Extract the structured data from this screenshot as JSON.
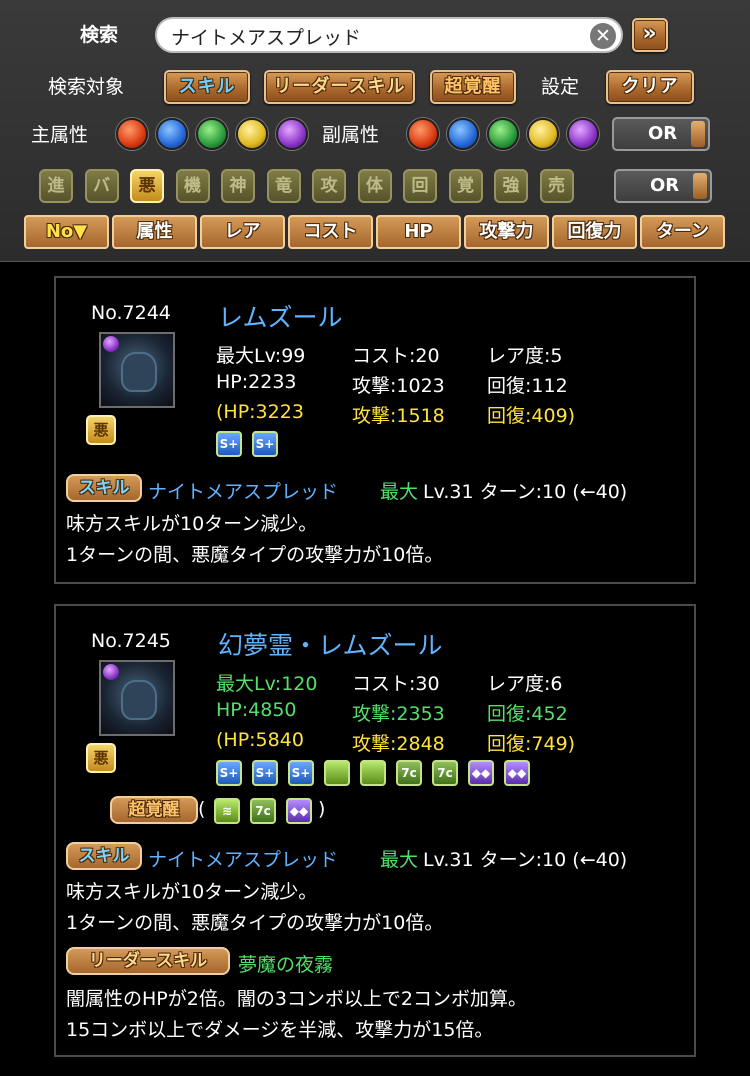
{
  "search": {
    "title": "検索",
    "query": "ナイトメアスプレッド",
    "clear_glyph": "✕",
    "go_glyph": "»"
  },
  "target_row": {
    "label": "検索対象",
    "skill": "スキル",
    "leader": "リーダースキル",
    "super": "超覚醒",
    "settings_label": "設定",
    "clear": "クリア"
  },
  "attr_row": {
    "main_label": "主属性",
    "sub_label": "副属性",
    "toggle": "OR"
  },
  "type_row": {
    "toggle": "OR",
    "types": [
      {
        "name": "evo-icon",
        "glyph": "進"
      },
      {
        "name": "balance-icon",
        "glyph": "バ"
      },
      {
        "name": "devil-icon",
        "glyph": "悪"
      },
      {
        "name": "machine-icon",
        "glyph": "機"
      },
      {
        "name": "god-icon",
        "glyph": "神"
      },
      {
        "name": "dragon-icon",
        "glyph": "竜"
      },
      {
        "name": "attacker-icon",
        "glyph": "攻"
      },
      {
        "name": "physical-icon",
        "glyph": "体"
      },
      {
        "name": "healer-icon",
        "glyph": "回"
      },
      {
        "name": "awaken-material-icon",
        "glyph": "覚"
      },
      {
        "name": "enhance-material-icon",
        "glyph": "強"
      },
      {
        "name": "sell-icon",
        "glyph": "売"
      }
    ]
  },
  "sort": [
    "No▼",
    "属性",
    "レア",
    "コスト",
    "HP",
    "攻撃力",
    "回復力",
    "ターン"
  ],
  "cards": [
    {
      "no": "No.7244",
      "name": "レムズール",
      "maxlv": "最大Lv:99",
      "cost": "コスト:20",
      "rarity": "レア度:5",
      "hp": "HP:2233",
      "atk": "攻撃:1023",
      "rcv": "回復:112",
      "hp_plus": "(HP:3223",
      "atk_plus": "攻撃:1518",
      "rcv_plus": "回復:409)",
      "skill_tag": "スキル",
      "skill_name": "ナイトメアスプレッド",
      "skill_max": "最大",
      "skill_lv": "Lv.31 ターン:10 (←40)",
      "skill_desc1": "味方スキルが10ターン減少。",
      "skill_desc2": "1ターンの間、悪魔タイプの攻撃力が10倍。"
    },
    {
      "no": "No.7245",
      "name": "幻夢霊・レムズール",
      "maxlv": "最大Lv:120",
      "cost": "コスト:30",
      "rarity": "レア度:6",
      "hp": "HP:4850",
      "atk": "攻撃:2353",
      "rcv": "回復:452",
      "hp_plus": "(HP:5840",
      "atk_plus": "攻撃:2848",
      "rcv_plus": "回復:749)",
      "super_label": "超覚醒",
      "super_open": "(",
      "super_close": ")",
      "skill_tag": "スキル",
      "skill_name": "ナイトメアスプレッド",
      "skill_max": "最大",
      "skill_lv": "Lv.31 ターン:10 (←40)",
      "skill_desc1": "味方スキルが10ターン減少。",
      "skill_desc2": "1ターンの間、悪魔タイプの攻撃力が10倍。",
      "ls_tag": "リーダースキル",
      "ls_name": "夢魔の夜霧",
      "ls_desc1": "闇属性のHPが2倍。闇の3コンボ以上で2コンボ加算。",
      "ls_desc2": "15コンボ以上でダメージを半減、攻撃力が15倍。"
    }
  ],
  "awakening_glyphs": {
    "skill_boost": "S+",
    "seven": "7c",
    "purple": "◆◆",
    "green": "≋"
  },
  "colors": {
    "name_blue": "#5fb3ff",
    "stat_green": "#53e06a",
    "plus_yellow": "#ffe23a"
  }
}
